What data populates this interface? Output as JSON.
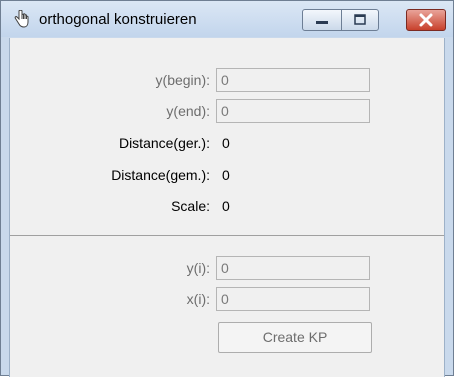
{
  "window": {
    "title": "orthogonal konstruieren",
    "icons": {
      "app": "hand-pointer-icon",
      "minimize": "minimize-icon",
      "maximize": "maximize-icon",
      "close": "close-x-icon"
    }
  },
  "fields": {
    "y_begin": {
      "label": "y(begin):",
      "value": "0"
    },
    "y_end": {
      "label": "y(end):",
      "value": "0"
    }
  },
  "info": {
    "distance_ger": {
      "label": "Distance(ger.):",
      "value": "0"
    },
    "distance_gem": {
      "label": "Distance(gem.):",
      "value": "0"
    },
    "scale": {
      "label": "Scale:",
      "value": "0"
    }
  },
  "point": {
    "y_i": {
      "label": "y(i):",
      "value": "0"
    },
    "x_i": {
      "label": "x(i):",
      "value": "0"
    },
    "create_button": "Create KP"
  },
  "colors": {
    "close_button": "#c8412c",
    "disabled_text": "#6d6d6d",
    "frame": "#c9d9ec"
  }
}
